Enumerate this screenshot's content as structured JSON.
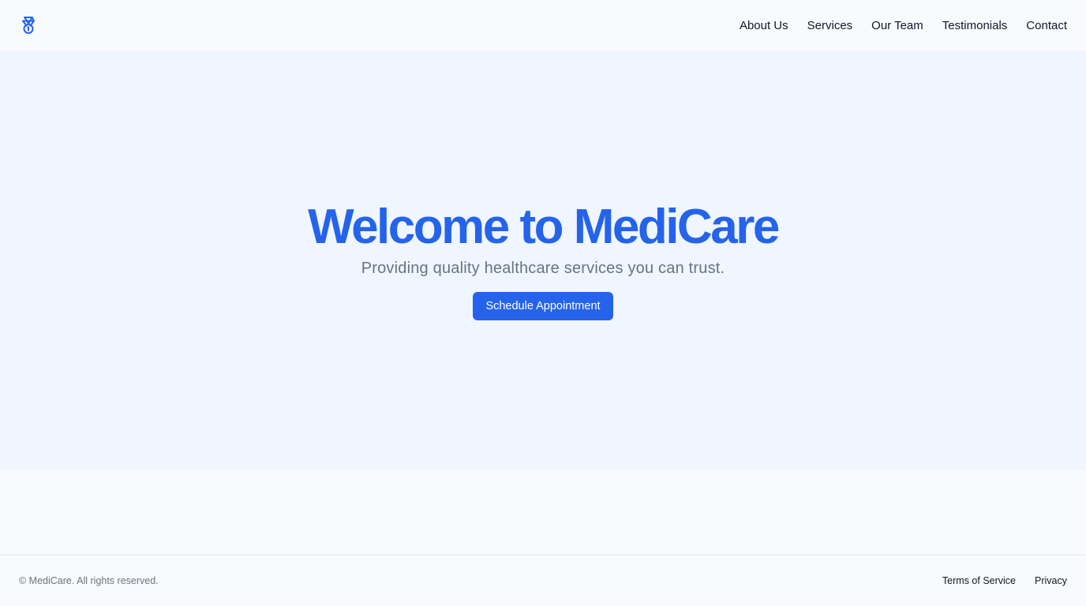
{
  "header": {
    "logo_icon": "medal-icon",
    "nav": [
      {
        "label": "About Us"
      },
      {
        "label": "Services"
      },
      {
        "label": "Our Team"
      },
      {
        "label": "Testimonials"
      },
      {
        "label": "Contact"
      }
    ]
  },
  "hero": {
    "title": "Welcome to MediCare",
    "subtitle": "Providing quality healthcare services you can trust.",
    "cta_label": "Schedule Appointment"
  },
  "footer": {
    "copyright": "© MediCare. All rights reserved.",
    "links": [
      {
        "label": "Terms of Service"
      },
      {
        "label": "Privacy"
      }
    ]
  },
  "colors": {
    "accent": "#2563eb",
    "hero_bg": "#eff6ff",
    "page_bg": "#f8fafc",
    "muted_text": "#6b7280"
  }
}
